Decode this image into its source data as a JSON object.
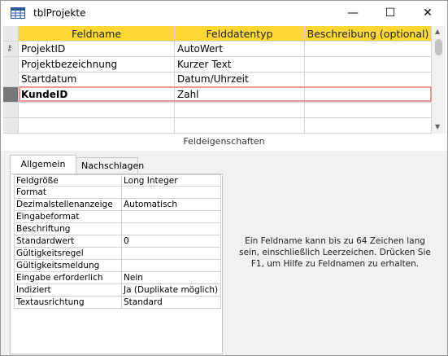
{
  "window": {
    "title": "tblProjekte",
    "minimize_glyph": "—",
    "maximize_glyph": "☐",
    "close_glyph": "✕"
  },
  "grid": {
    "headers": [
      "Feldname",
      "Felddatentyp",
      "Beschreibung (optional)"
    ],
    "rows": [
      {
        "name": "ProjektID",
        "type": "AutoWert",
        "description": "",
        "primary_key": true
      },
      {
        "name": "Projektbezeichnung",
        "type": "Kurzer Text",
        "description": ""
      },
      {
        "name": "Startdatum",
        "type": "Datum/Uhrzeit",
        "description": ""
      },
      {
        "name": "KundeID",
        "type": "Zahl",
        "description": "",
        "active": true
      },
      {
        "name": "",
        "type": "",
        "description": ""
      },
      {
        "name": "",
        "type": "",
        "description": ""
      }
    ]
  },
  "properties": {
    "section_label": "Feldeigenschaften",
    "tabs": [
      "Allgemein",
      "Nachschlagen"
    ],
    "active_tab": "Allgemein",
    "rows": [
      {
        "name": "Feldgröße",
        "value": "Long Integer"
      },
      {
        "name": "Format",
        "value": ""
      },
      {
        "name": "Dezimalstellenanzeige",
        "value": "Automatisch"
      },
      {
        "name": "Eingabeformat",
        "value": ""
      },
      {
        "name": "Beschriftung",
        "value": ""
      },
      {
        "name": "Standardwert",
        "value": "0"
      },
      {
        "name": "Gültigkeitsregel",
        "value": ""
      },
      {
        "name": "Gültigkeitsmeldung",
        "value": ""
      },
      {
        "name": "Eingabe erforderlich",
        "value": "Nein"
      },
      {
        "name": "Indiziert",
        "value": "Ja (Duplikate möglich)"
      },
      {
        "name": "Textausrichtung",
        "value": "Standard"
      }
    ],
    "help_text": "Ein Feldname kann bis zu 64 Zeichen lang sein, einschließlich Leerzeichen. Drücken Sie F1, um Hilfe zu Feldnamen zu erhalten."
  }
}
